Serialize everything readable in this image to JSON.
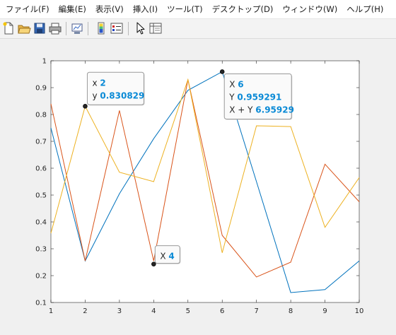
{
  "menu": [
    "ファイル(F)",
    "編集(E)",
    "表示(V)",
    "挿入(I)",
    "ツール(T)",
    "デスクトップ(D)",
    "ウィンドウ(W)",
    "ヘルプ(H)"
  ],
  "toolbar": [
    {
      "name": "new-figure-icon"
    },
    {
      "name": "open-file-icon"
    },
    {
      "name": "save-icon"
    },
    {
      "name": "print-icon"
    },
    {
      "name": "link-plot-icon"
    },
    {
      "name": "insert-colorbar-icon"
    },
    {
      "name": "insert-legend-icon"
    },
    {
      "name": "edit-plot-arrow-icon"
    },
    {
      "name": "property-inspector-icon"
    }
  ],
  "chart_data": {
    "type": "line",
    "x": [
      1,
      2,
      3,
      4,
      5,
      6,
      7,
      8,
      9,
      10
    ],
    "xlim": [
      1,
      10
    ],
    "ylim": [
      0.1,
      1
    ],
    "xticks": [
      "1",
      "2",
      "3",
      "4",
      "5",
      "6",
      "7",
      "8",
      "9",
      "10"
    ],
    "yticks": [
      "0.1",
      "0.2",
      "0.3",
      "0.4",
      "0.5",
      "0.6",
      "0.7",
      "0.8",
      "0.9",
      "1"
    ],
    "grid": false,
    "series": [
      {
        "color": "#0072bd",
        "values": [
          0.75,
          0.255,
          0.505,
          0.71,
          0.89,
          0.959291,
          0.55,
          0.137,
          0.148,
          0.255
        ]
      },
      {
        "color": "#d95319",
        "values": [
          0.84,
          0.255,
          0.815,
          0.255,
          0.93,
          0.35,
          0.195,
          0.25,
          0.615,
          0.475
        ]
      },
      {
        "color": "#edb120",
        "values": [
          0.358,
          0.830829,
          0.585,
          0.55,
          0.93,
          0.285,
          0.758,
          0.755,
          0.38,
          0.565
        ]
      }
    ],
    "datatips": [
      {
        "x": 2,
        "y": 0.830829,
        "color": "#edb120",
        "lines": [
          {
            "label": "x",
            "value": "2"
          },
          {
            "label": "y",
            "value": "0.830829"
          }
        ]
      },
      {
        "x": 6,
        "y": 0.959291,
        "color": "#0072bd",
        "lines": [
          {
            "label": "X",
            "value": "6"
          },
          {
            "label": "Y",
            "value": "0.959291"
          },
          {
            "label": "X + Y",
            "value": "6.95929"
          }
        ]
      },
      {
        "x": 4,
        "y": 0.243,
        "color": "#d95319",
        "lines": [
          {
            "label": "X",
            "value": "4"
          }
        ]
      }
    ]
  }
}
